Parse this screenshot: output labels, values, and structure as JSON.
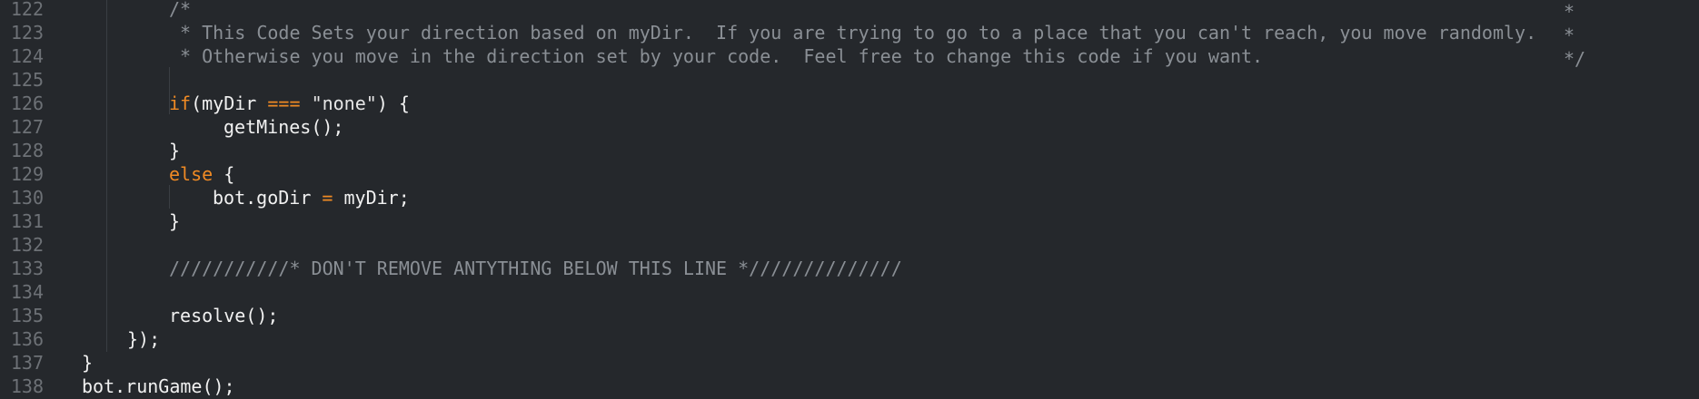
{
  "editor": {
    "lines": [
      {
        "num": "122",
        "segments": [
          {
            "t": "/*",
            "c": "cm"
          }
        ]
      },
      {
        "num": "123",
        "segments": [
          {
            "t": " * This Code Sets your direction based on myDir.  If you are trying to go to a place that you can't reach, you move randomly.",
            "c": "cm"
          }
        ]
      },
      {
        "num": "124",
        "segments": [
          {
            "t": " * Otherwise you move in the direction set by your code.  Feel free to change this code if you want.",
            "c": "cm"
          }
        ]
      },
      {
        "num": "125",
        "segments": []
      },
      {
        "num": "126",
        "segments": [
          {
            "t": "if",
            "c": "kw"
          },
          {
            "t": "(myDir ",
            "c": ""
          },
          {
            "t": "===",
            "c": "op"
          },
          {
            "t": " ",
            "c": ""
          },
          {
            "t": "\"none\"",
            "c": "str"
          },
          {
            "t": ") {",
            "c": ""
          }
        ]
      },
      {
        "num": "127",
        "segments": [
          {
            "t": "getMines();",
            "c": ""
          }
        ]
      },
      {
        "num": "128",
        "segments": [
          {
            "t": "}",
            "c": ""
          }
        ]
      },
      {
        "num": "129",
        "segments": [
          {
            "t": "else",
            "c": "kw"
          },
          {
            "t": " {",
            "c": ""
          }
        ]
      },
      {
        "num": "130",
        "segments": [
          {
            "t": "bot.goDir ",
            "c": ""
          },
          {
            "t": "=",
            "c": "op"
          },
          {
            "t": " myDir;",
            "c": ""
          }
        ]
      },
      {
        "num": "131",
        "segments": [
          {
            "t": "}",
            "c": ""
          }
        ]
      },
      {
        "num": "132",
        "segments": []
      },
      {
        "num": "133",
        "segments": [
          {
            "t": "///////////* DON'T REMOVE ANTYTHING BELOW THIS LINE *//////////////",
            "c": "cm"
          }
        ]
      },
      {
        "num": "134",
        "segments": []
      },
      {
        "num": "135",
        "segments": [
          {
            "t": "resolve();",
            "c": ""
          }
        ]
      },
      {
        "num": "136",
        "segments": [
          {
            "t": "});",
            "c": ""
          }
        ]
      },
      {
        "num": "137",
        "segments": [
          {
            "t": "}",
            "c": ""
          }
        ]
      },
      {
        "num": "138",
        "segments": [
          {
            "t": "bot.runGame();",
            "c": ""
          }
        ]
      }
    ],
    "right_comment": {
      "row122": "*",
      "row123": "*",
      "row124": "*/"
    }
  }
}
